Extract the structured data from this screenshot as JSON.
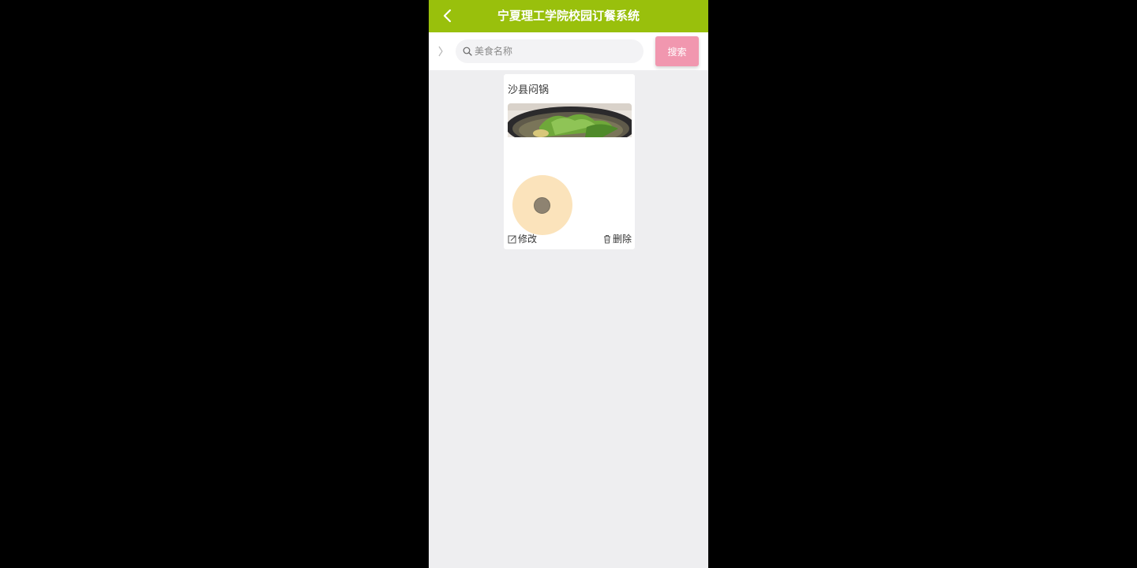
{
  "header": {
    "title": "宁夏理工学院校园订餐系统"
  },
  "search": {
    "placeholder": "美食名称",
    "value": "",
    "button_label": "搜索"
  },
  "items": [
    {
      "name": "沙县闷锅",
      "edit_label": "修改",
      "delete_label": "删除"
    }
  ],
  "colors": {
    "header_bg": "#99c00c",
    "search_button_bg": "#f197af",
    "page_bg": "#eeeef0"
  },
  "icons": [
    "back-arrow-icon",
    "chevron-right-icon",
    "search-icon",
    "edit-icon",
    "trash-icon"
  ]
}
